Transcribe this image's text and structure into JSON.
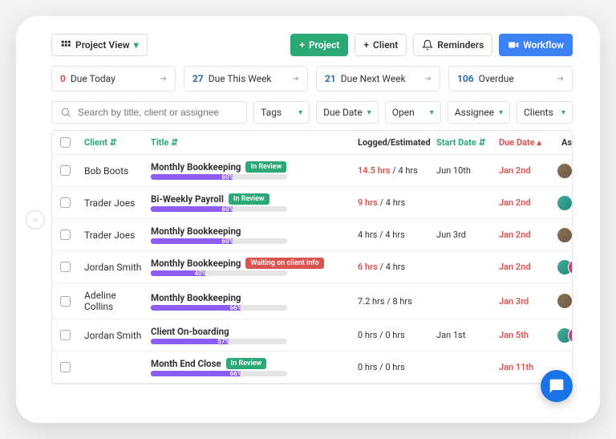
{
  "topbar": {
    "project_view": "Project View",
    "project_btn": "Project",
    "client_btn": "Client",
    "reminders_btn": "Reminders",
    "workflow_btn": "Workflow"
  },
  "summary": [
    {
      "num": "0",
      "label": "Due Today",
      "num_color": "#d9534f"
    },
    {
      "num": "27",
      "label": "Due This Week",
      "num_color": "#2b6cb0"
    },
    {
      "num": "21",
      "label": "Due Next Week",
      "num_color": "#2b6cb0"
    },
    {
      "num": "106",
      "label": "Overdue",
      "num_color": "#2b6cb0"
    }
  ],
  "search": {
    "placeholder": "Search by title, client or assignee"
  },
  "filters": {
    "tags": "Tags",
    "due_date": "Due Date",
    "open": "Open",
    "assignee": "Assignee",
    "clients": "Clients"
  },
  "columns": {
    "client": "Client",
    "title": "Title",
    "logged": "Logged/Estimated",
    "start": "Start Date",
    "due": "Due Date",
    "assignees": "Assignees"
  },
  "rows": [
    {
      "client": "Bob Boots",
      "title": "Monthly Bookkeeping",
      "badge": "In Review",
      "badge_type": "green",
      "progress": 60,
      "logged": "14.5 hrs",
      "over": true,
      "est": "4 hrs",
      "start": "Jun 10th",
      "due": "Jan 2nd",
      "avatars": 1
    },
    {
      "client": "Trader Joes",
      "title": "Bi-Weekly Payroll",
      "badge": "In Review",
      "badge_type": "green",
      "progress": 60,
      "logged": "9 hrs",
      "over": true,
      "est": "4 hrs",
      "start": "",
      "due": "Jan 2nd",
      "avatars": 1
    },
    {
      "client": "Trader Joes",
      "title": "Monthly Bookkeeping",
      "badge": "",
      "badge_type": "",
      "progress": 60,
      "logged": "4 hrs",
      "over": false,
      "est": "4 hrs",
      "start": "Jun 3rd",
      "due": "Jan 2nd",
      "avatars": 1
    },
    {
      "client": "Jordan Smith",
      "title": "Monthly Bookkeeping",
      "badge": "Waiting on client info",
      "badge_type": "red",
      "progress": 40,
      "logged": "6 hrs",
      "over": true,
      "est": "4 hrs",
      "start": "",
      "due": "Jan 2nd",
      "avatars": 2
    },
    {
      "client": "Adeline Collins",
      "title": "Monthly Bookkeeping",
      "badge": "",
      "badge_type": "",
      "progress": 66,
      "logged": "7.2 hrs",
      "over": false,
      "est": "8 hrs",
      "start": "",
      "due": "Jan 3rd",
      "avatars": 1
    },
    {
      "client": "Jordan Smith",
      "title": "Client On-boarding",
      "badge": "",
      "badge_type": "",
      "progress": 57,
      "logged": "0 hrs",
      "over": false,
      "est": "0 hrs",
      "start": "Jan 1st",
      "due": "Jan 5th",
      "avatars": 2
    },
    {
      "client": "",
      "title": "Month End Close",
      "badge": "In Review",
      "badge_type": "green",
      "progress": 66,
      "logged": "0 hrs",
      "over": false,
      "est": "0 hrs",
      "start": "",
      "due": "Jan 11th",
      "avatars": 0
    }
  ]
}
